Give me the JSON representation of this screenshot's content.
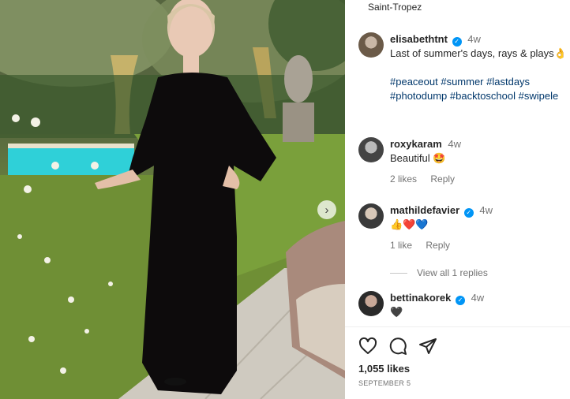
{
  "post": {
    "location": "Saint-Tropez",
    "author": "elisabethtnt",
    "time": "4w",
    "caption_line1": "Last of summer's days, rays & plays",
    "caption_emoji": "👌",
    "hashtags_line1": "#peaceout #summer #lastdays",
    "hashtags_line2": "#photodump #backtoschool #swipele"
  },
  "comments": [
    {
      "user": "roxykaram",
      "time": "4w",
      "text": "Beautiful 🤩",
      "likes": "2 likes",
      "reply": "Reply",
      "verified": false
    },
    {
      "user": "mathildefavier",
      "time": "4w",
      "text": "👍❤️💙",
      "likes": "1 like",
      "reply": "Reply",
      "verified": true
    },
    {
      "user": "bettinakorek",
      "time": "4w",
      "text": "🖤",
      "verified": true
    }
  ],
  "view_replies": "View all 1 replies",
  "likes_count": "1,055 likes",
  "date": "SEPTEMBER 5",
  "colors": {
    "verified": "#0095f6",
    "hashtag": "#00376b",
    "meta": "#737373"
  },
  "icons": [
    "chevron-right-icon",
    "verified-icon",
    "heart-icon",
    "comment-icon",
    "share-icon"
  ]
}
